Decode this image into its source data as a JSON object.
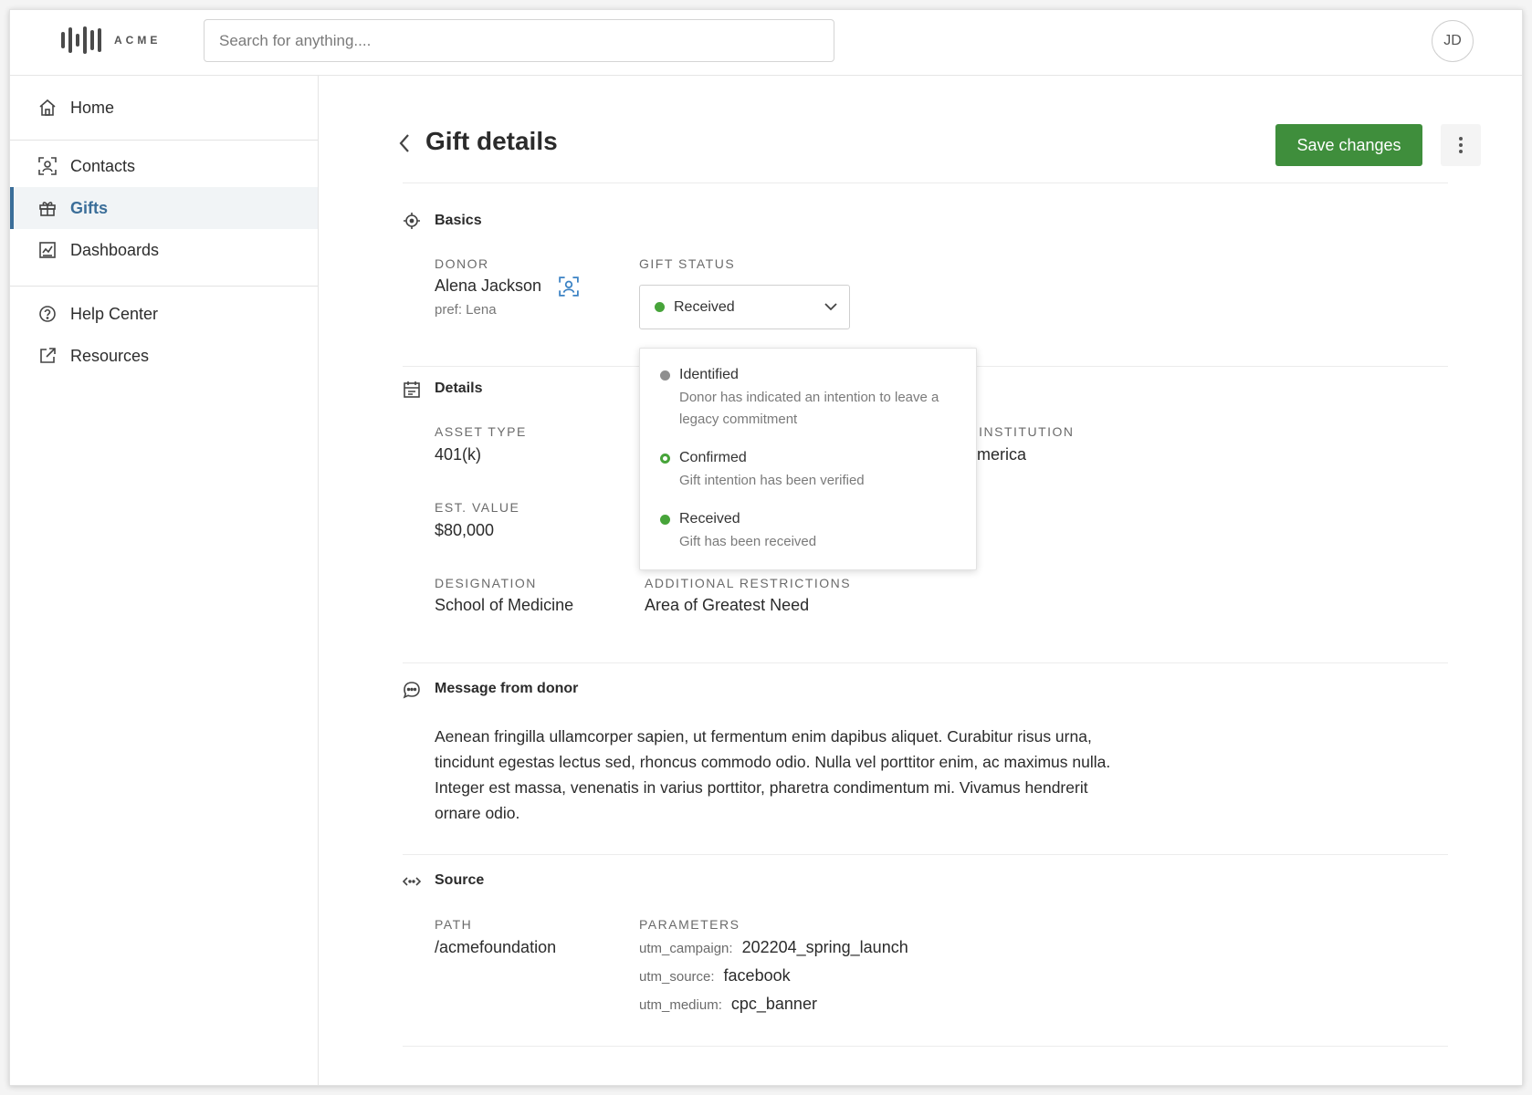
{
  "app": {
    "logo_text": "ACME",
    "avatar_initials": "JD"
  },
  "search": {
    "placeholder": "Search for anything...."
  },
  "sidebar": {
    "items": [
      {
        "label": "Home",
        "icon": "home-icon"
      },
      {
        "label": "Contacts",
        "icon": "contact-icon"
      },
      {
        "label": "Gifts",
        "icon": "gift-icon",
        "active": true
      },
      {
        "label": "Dashboards",
        "icon": "chart-icon"
      },
      {
        "label": "Help Center",
        "icon": "help-icon"
      },
      {
        "label": "Resources",
        "icon": "external-link-icon"
      }
    ]
  },
  "header": {
    "title": "Gift details",
    "save_label": "Save changes"
  },
  "basics": {
    "title": "Basics",
    "donor_label": "DONOR",
    "donor_name": "Alena Jackson",
    "donor_pref": "pref: Lena",
    "status_label": "GIFT STATUS",
    "status_value": "Received"
  },
  "status_options": [
    {
      "label": "Identified",
      "description": "Donor has indicated an intention to leave a legacy commitment",
      "color": "#8f8f8f"
    },
    {
      "label": "Confirmed",
      "description": "Gift intention has been verified",
      "color": "#47a43a"
    },
    {
      "label": "Received",
      "description": "Gift has been received",
      "color": "#47a43a"
    }
  ],
  "details": {
    "title": "Details",
    "asset_type_label": "ASSET TYPE",
    "asset_type_value": "401(k)",
    "institution_label_visible": "L INSTITUTION",
    "institution_value_visible": "America",
    "est_value_label": "EST. VALUE",
    "est_value_value": "$80,000",
    "designation_label": "DESIGNATION",
    "designation_value": "School of Medicine",
    "restrictions_label": "ADDITIONAL RESTRICTIONS",
    "restrictions_value": "Area of Greatest Need"
  },
  "message": {
    "title": "Message from donor",
    "body": "Aenean fringilla ullamcorper sapien, ut fermentum enim dapibus aliquet. Curabitur risus urna, tincidunt egestas lectus sed, rhoncus commodo odio. Nulla vel porttitor enim, ac maximus nulla. Integer est massa, venenatis in varius porttitor, pharetra condimentum mi. Vivamus hendrerit ornare odio."
  },
  "source": {
    "title": "Source",
    "path_label": "PATH",
    "path_value": "/acmefoundation",
    "params_label": "PARAMETERS",
    "params": [
      {
        "key": "utm_campaign:",
        "value": "202204_spring_launch"
      },
      {
        "key": "utm_source:",
        "value": "facebook"
      },
      {
        "key": "utm_medium:",
        "value": "cpc_banner"
      }
    ]
  },
  "colors": {
    "accent": "#3b6e99",
    "primary_button": "#3f8e3c",
    "status_green": "#47a43a",
    "status_gray": "#8f8f8f"
  }
}
